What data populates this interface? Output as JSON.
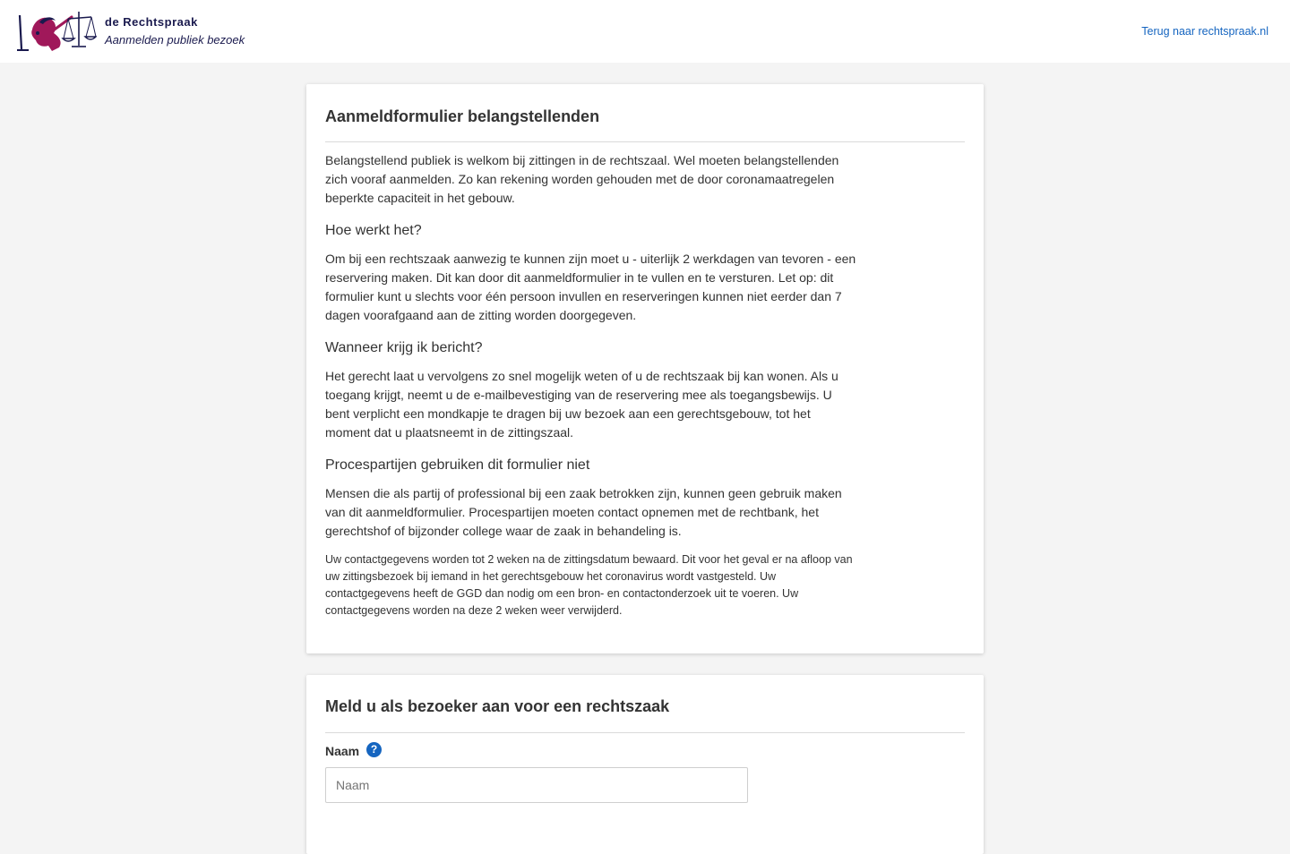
{
  "header": {
    "brand_name": "de Rechtspraak",
    "brand_subtitle": "Aanmelden publiek bezoek",
    "back_link": "Terug naar rechtspraak.nl",
    "logo_colors": {
      "figure": "#a0185a",
      "ink": "#1a1a4e"
    }
  },
  "info_card": {
    "title": "Aanmeldformulier belangstellenden",
    "intro": "Belangstellend publiek is welkom bij zittingen in de rechtszaal. Wel moeten belangstellenden zich vooraf aanmelden. Zo kan rekening worden gehouden met de door coronamaatregelen beperkte capaciteit in het gebouw.",
    "sections": [
      {
        "heading": "Hoe werkt het?",
        "text": "Om bij een rechtszaak aanwezig te kunnen zijn moet u - uiterlijk 2 werkdagen van tevoren - een reservering maken. Dit kan door dit aanmeldformulier in te vullen en te versturen. Let op: dit formulier kunt u slechts voor één persoon invullen en reserveringen kunnen niet eerder dan 7 dagen voorafgaand aan de zitting worden doorgegeven."
      },
      {
        "heading": "Wanneer krijg ik bericht?",
        "text": "Het gerecht laat u vervolgens zo snel mogelijk weten of u de rechtszaak bij kan wonen. Als u toegang krijgt, neemt u de e-mailbevestiging van de reservering mee als toegangsbewijs. U bent verplicht een mondkapje te dragen bij uw bezoek aan een gerechtsgebouw, tot het moment dat u plaatsneemt in de zittingszaal."
      },
      {
        "heading": "Procespartijen gebruiken dit formulier niet",
        "text": "Mensen die als partij of professional bij een zaak betrokken zijn, kunnen geen gebruik maken van dit aanmeldformulier. Procespartijen moeten contact opnemen met de rechtbank, het gerechtshof of bijzonder college waar de zaak in behandeling is."
      }
    ],
    "privacy_note": "Uw contactgegevens worden tot 2 weken na de zittingsdatum bewaard. Dit voor het geval er na afloop van uw zittingsbezoek bij iemand in het gerechtsgebouw het coronavirus wordt vastgesteld. Uw contactgegevens heeft de GGD dan nodig om een bron- en contactonderzoek uit te voeren. Uw contactgegevens worden na deze 2 weken weer verwijderd."
  },
  "form_card": {
    "title": "Meld u als bezoeker aan voor een rechtszaak",
    "name_label": "Naam",
    "name_help_icon": "question-circle-icon",
    "name_placeholder": "Naam",
    "name_value": ""
  },
  "colors": {
    "link": "#1565c0",
    "background": "#f4f4f4",
    "card": "#ffffff"
  }
}
